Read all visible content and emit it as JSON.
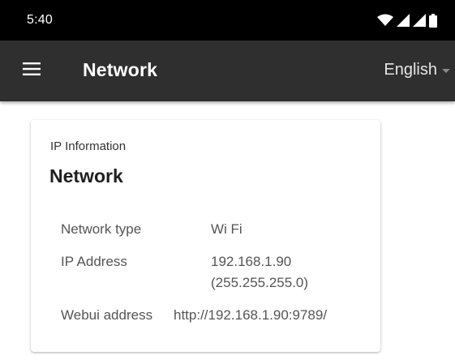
{
  "status_bar": {
    "time": "5:40",
    "icons": [
      "wifi-icon",
      "signal-icon",
      "signal-icon",
      "battery-icon"
    ]
  },
  "app_bar": {
    "menu_icon": "menu-icon",
    "title": "Network",
    "language": {
      "selected": "English",
      "icon": "caret-down-icon"
    }
  },
  "card": {
    "overline": "IP Information",
    "title": "Network",
    "rows": [
      {
        "label": "Network type",
        "value": "Wi Fi"
      },
      {
        "label": "IP Address",
        "value": "192.168.1.90",
        "value_secondary": "(255.255.255.0)"
      },
      {
        "label": "Webui address",
        "value": "http://192.168.1.90:9789/"
      }
    ]
  },
  "colors": {
    "status_bar_bg": "#000000",
    "app_bar_bg": "#2f2f2f",
    "card_bg": "#ffffff",
    "text_secondary": "#555555"
  }
}
